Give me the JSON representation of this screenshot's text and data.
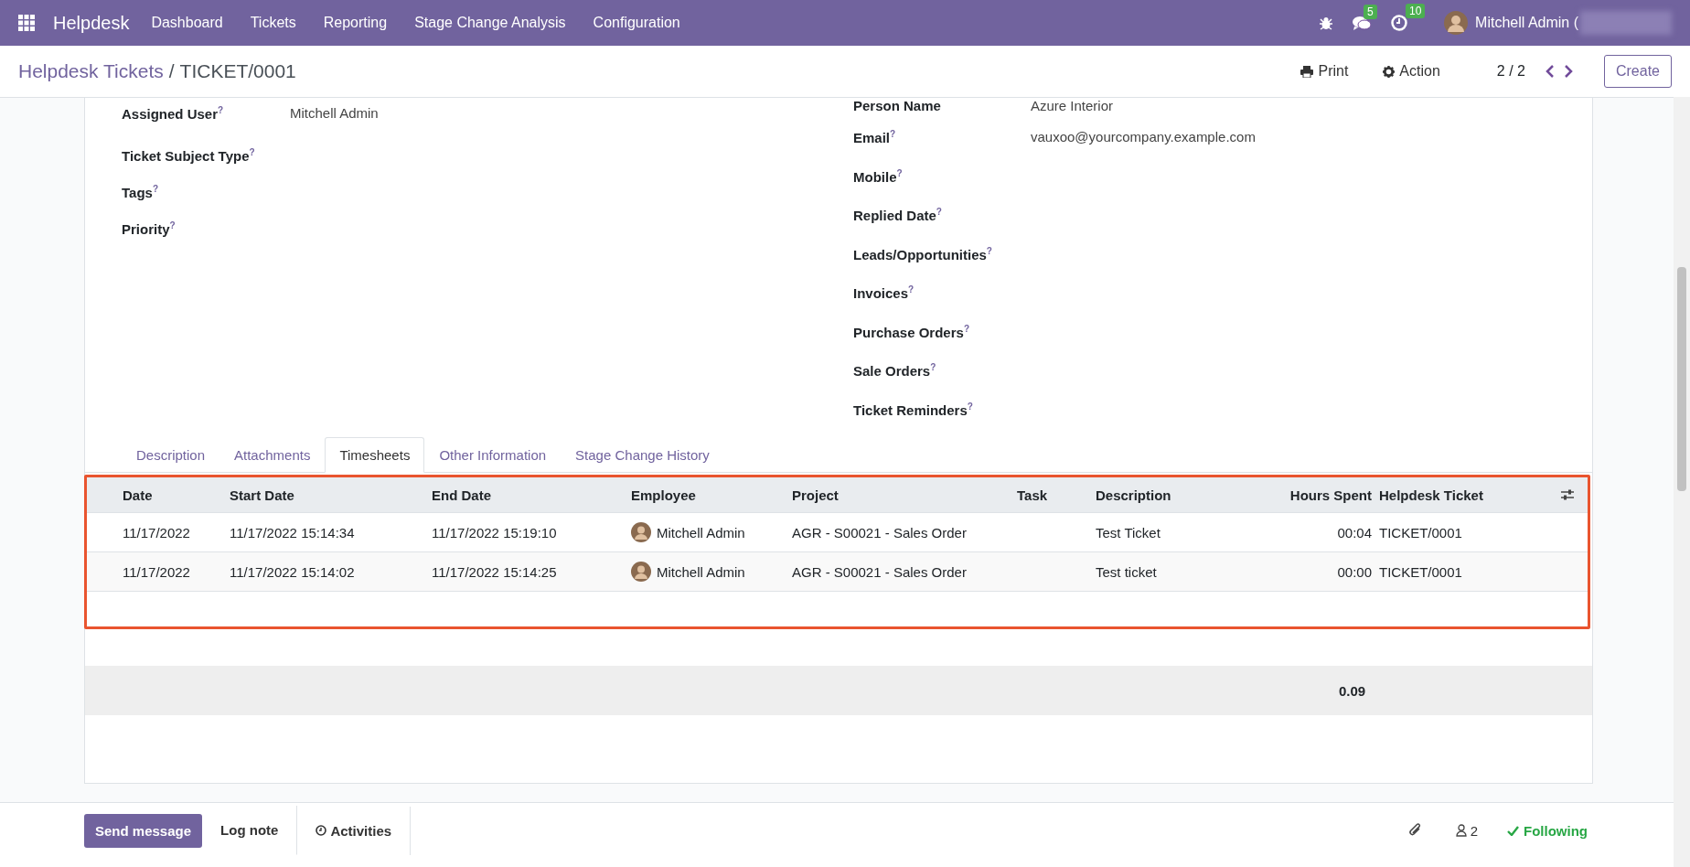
{
  "navbar": {
    "app_name": "Helpdesk",
    "menu": [
      "Dashboard",
      "Tickets",
      "Reporting",
      "Stage Change Analysis",
      "Configuration"
    ],
    "messages_count": "5",
    "activities_count": "10",
    "user": "Mitchell Admin ("
  },
  "breadcrumb": {
    "parent": "Helpdesk Tickets",
    "separator": "/",
    "current": "TICKET/0001"
  },
  "control_panel": {
    "print": "Print",
    "action": "Action",
    "pager": "2 / 2",
    "create": "Create"
  },
  "form": {
    "left_fields": [
      {
        "label": "Assigned User$^{?}$",
        "value": "Mitchell Admin"
      },
      {
        "label": "Ticket Subject Type$^{?}$"
      },
      {
        "label": "Tags$^{?}$"
      },
      {
        "label": "Priority$^{?}$"
      }
    ],
    "right_fields": [
      {
        "label": "Person Name",
        "value": "Azure Interior"
      },
      {
        "label": "Email$^{?}$",
        "value": "vauxoo@yourcompany.example.com"
      },
      {
        "label": "Mobile$^{?}$"
      },
      {
        "label": "Replied Date$^{?}$"
      },
      {
        "label": "Leads/Opportunities$^{?}$"
      },
      {
        "label": "Invoices$^{?}$"
      },
      {
        "label": "Purchase Orders$^{?}$"
      },
      {
        "label": "Sale Orders$^{?}$"
      },
      {
        "label": "Ticket Reminders$^{?}$"
      }
    ]
  },
  "tabs": [
    {
      "label": "Description",
      "selected": false
    },
    {
      "label": "Attachments",
      "selected": false
    },
    {
      "label": "Timesheets",
      "selected": true
    },
    {
      "label": "Other Information",
      "selected": false
    },
    {
      "label": "Stage Change History",
      "selected": false
    }
  ],
  "timesheets": {
    "columns": [
      "Date",
      "Start Date",
      "End Date",
      "Employee",
      "Project",
      "Task",
      "Description",
      "Hours Spent",
      "Helpdesk Ticket"
    ],
    "rows": [
      {
        "date": "11/17/2022",
        "start": "11/17/2022 15:14:34",
        "end": "11/17/2022 15:19:10",
        "employee": "Mitchell Admin",
        "project": "AGR - S00021 - Sales Order",
        "description": "Test Ticket",
        "hours": "00:04",
        "ticket": "TICKET/0001"
      },
      {
        "date": "11/17/2022",
        "start": "11/17/2022 15:14:02",
        "end": "11/17/2022 15:14:25",
        "employee": "Mitchell Admin",
        "project": "AGR - S00021 - Sales Order",
        "description": "Test ticket",
        "hours": "00:00",
        "ticket": "TICKET/0001"
      }
    ],
    "total": "0.09"
  },
  "chatter": {
    "send_message": "Send message",
    "log_note": "Log note",
    "activities": "Activities",
    "followers": "2",
    "following": "Following"
  }
}
